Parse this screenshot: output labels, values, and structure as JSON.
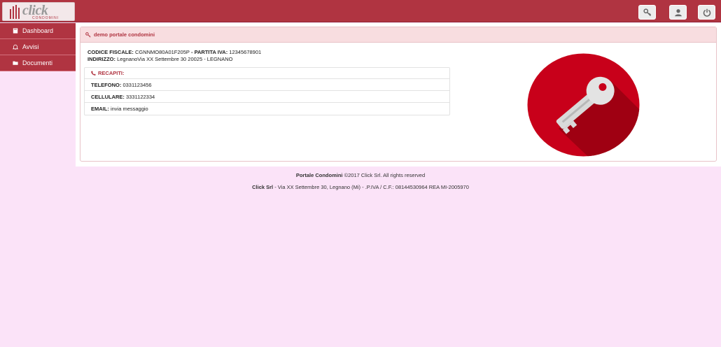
{
  "logo": {
    "word": "click",
    "sub": "CONDOMINI"
  },
  "topbar": {
    "buttons": [
      {
        "icon": "key-icon"
      },
      {
        "icon": "user-icon"
      },
      {
        "icon": "power-icon"
      }
    ]
  },
  "sidebar": {
    "items": [
      {
        "label": "Dashboard",
        "icon": "book-icon"
      },
      {
        "label": "Avvisi",
        "icon": "bell-icon"
      },
      {
        "label": "Documenti",
        "icon": "folder-icon"
      }
    ]
  },
  "panel": {
    "title": "demo portale condomini",
    "codice_fiscale_label": "CODICE FISCALE:",
    "codice_fiscale": "CGNNMO80A01F205P",
    "separator": " - ",
    "partita_iva_label": "PARTITA IVA:",
    "partita_iva": "12345678901",
    "indirizzo_label": "INDIRIZZO:",
    "indirizzo": "LegnanoVia XX Settembre 30 20025 - LEGNANO",
    "recapiti_label": "RECAPITI:",
    "telefono_label": "TELEFONO:",
    "telefono": "0331123456",
    "cellulare_label": "CELLULARE:",
    "cellulare": "3331122334",
    "email_label": "EMAIL:",
    "email": "invia messaggio"
  },
  "footer": {
    "line1_bold": "Portale Condomini",
    "line1_rest": " ©2017 Click Srl. All rights reserved",
    "line2_bold": "Click Srl",
    "line2_rest": " - Via XX Settembre 30, Legnano (Mi) - .P.IVA / C.F.: 08144530964 REA MI-2005970"
  },
  "colors": {
    "brand": "#b03441",
    "background": "#fbe3f8",
    "key_circle": "#c8001a"
  }
}
